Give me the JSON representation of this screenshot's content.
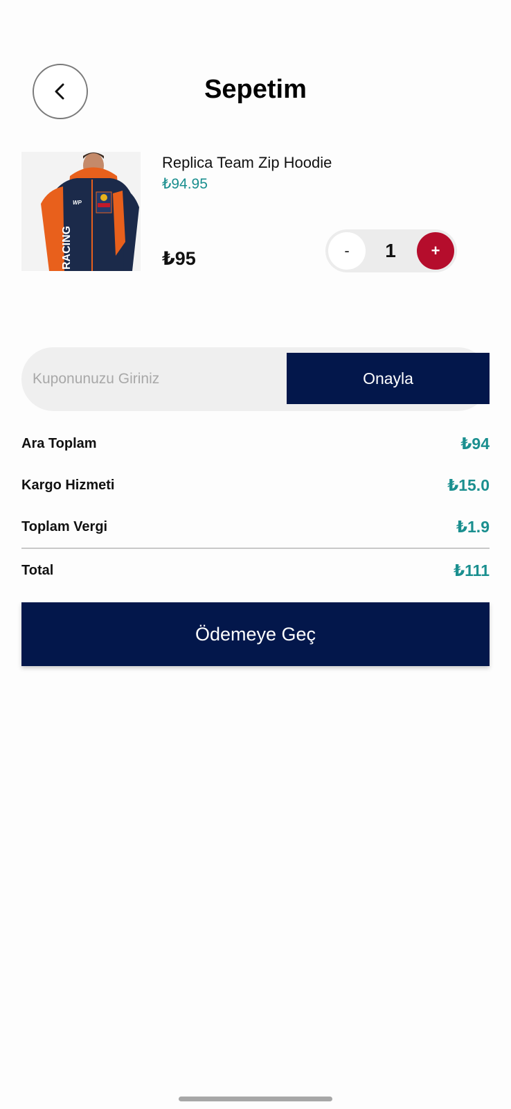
{
  "header": {
    "title": "Sepetim",
    "back_icon": "chevron-left-icon"
  },
  "cart": {
    "items": [
      {
        "name": "Replica Team Zip Hoodie",
        "unit_price": "₺94.95",
        "line_total": "₺95",
        "quantity": "1",
        "minus_label": "-",
        "plus_label": "+",
        "image_icon": "hoodie-product-image"
      }
    ]
  },
  "coupon": {
    "placeholder": "Kuponunuzu Giriniz",
    "value": "",
    "apply_label": "Onayla"
  },
  "summary": {
    "subtotal_label": "Ara Toplam",
    "subtotal_value": "₺94",
    "shipping_label": "Kargo Hizmeti",
    "shipping_value": "₺15.0",
    "tax_label": "Toplam Vergi",
    "tax_value": "₺1.9",
    "total_label": "Total",
    "total_value": "₺111"
  },
  "checkout": {
    "label": "Ödemeye Geç"
  },
  "colors": {
    "navy": "#03174b",
    "teal": "#1a8f8f",
    "red": "#b50d2c",
    "background": "#fdfdfd"
  }
}
